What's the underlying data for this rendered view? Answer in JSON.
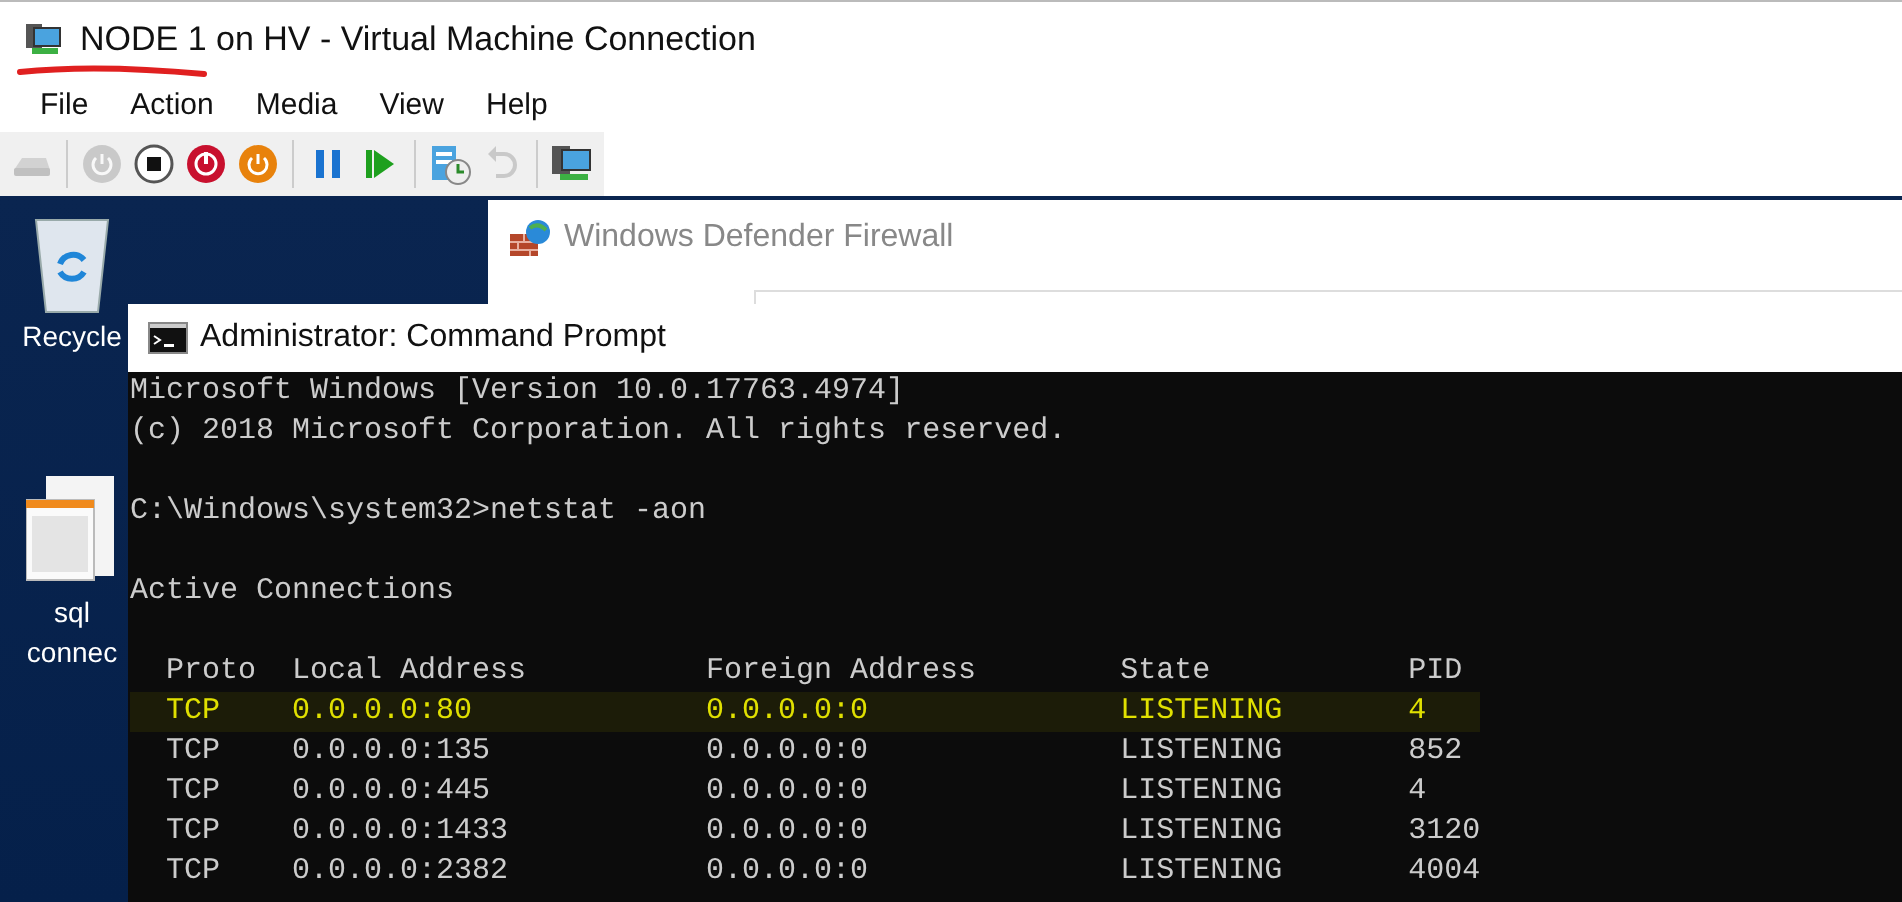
{
  "window": {
    "title": "NODE 1 on HV - Virtual Machine Connection"
  },
  "menu": [
    "File",
    "Action",
    "Media",
    "View",
    "Help"
  ],
  "toolbar": [
    [
      {
        "kind": "ctrl-alt-del",
        "disabled": true
      }
    ],
    [
      {
        "kind": "start",
        "disabled": true
      },
      {
        "kind": "turn-off",
        "disabled": false
      },
      {
        "kind": "shut-down",
        "disabled": false
      },
      {
        "kind": "save",
        "disabled": false
      }
    ],
    [
      {
        "kind": "pause",
        "disabled": false
      },
      {
        "kind": "reset",
        "disabled": false
      }
    ],
    [
      {
        "kind": "checkpoint",
        "disabled": false
      },
      {
        "kind": "revert",
        "disabled": true
      }
    ],
    [
      {
        "kind": "enhanced-session",
        "disabled": false
      }
    ]
  ],
  "desktop": {
    "icons": [
      {
        "kind": "recycle-bin",
        "label": [
          "Recycle"
        ]
      },
      {
        "kind": "document",
        "label": [
          "sql",
          "connec"
        ]
      }
    ]
  },
  "firewall_window": {
    "title": "Windows Defender Firewall"
  },
  "cmd_window": {
    "title": "Administrator: Command Prompt",
    "paragraphs": [
      [
        "Microsoft Windows [Version 10.0.17763.4974]",
        "(c) 2018 Microsoft Corporation. All rights reserved."
      ],
      [
        "C:\\Windows\\system32>netstat -aon"
      ],
      [
        "Active Connections"
      ]
    ],
    "columns": [
      "Proto",
      "Local Address",
      "Foreign Address",
      "State",
      "PID"
    ],
    "rows": [
      {
        "cells": [
          "TCP",
          "0.0.0.0:80",
          "0.0.0.0:0",
          "LISTENING",
          "4"
        ],
        "highlighted": true
      },
      {
        "cells": [
          "TCP",
          "0.0.0.0:135",
          "0.0.0.0:0",
          "LISTENING",
          "852"
        ],
        "highlighted": false
      },
      {
        "cells": [
          "TCP",
          "0.0.0.0:445",
          "0.0.0.0:0",
          "LISTENING",
          "4"
        ],
        "highlighted": false
      },
      {
        "cells": [
          "TCP",
          "0.0.0.0:1433",
          "0.0.0.0:0",
          "LISTENING",
          "3120"
        ],
        "highlighted": false
      },
      {
        "cells": [
          "TCP",
          "0.0.0.0:2382",
          "0.0.0.0:0",
          "LISTENING",
          "4004"
        ],
        "highlighted": false
      }
    ]
  }
}
